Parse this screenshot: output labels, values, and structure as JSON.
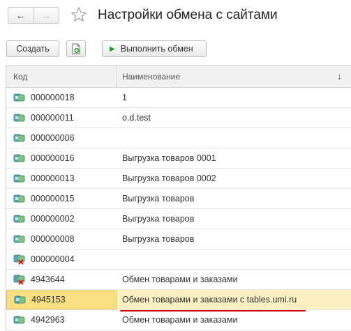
{
  "window": {
    "title": "Настройки обмена с сайтами",
    "nav": {
      "back_icon": "arrow-left-icon",
      "forward_icon": "arrow-right-icon"
    },
    "favorite_icon": "star-icon"
  },
  "toolbar": {
    "create_label": "Создать",
    "copy_icon": "copy-document-icon",
    "run_label": "Выполнить обмен",
    "run_icon": "play-icon"
  },
  "table": {
    "columns": {
      "code": "Код",
      "name": "Наименование",
      "sort_icon": "sort-arrow-down-icon"
    },
    "rows": [
      {
        "code": "000000018",
        "name": "1",
        "marked_for_deletion": false,
        "selected": false
      },
      {
        "code": "000000011",
        "name": "o.d.test",
        "marked_for_deletion": false,
        "selected": false
      },
      {
        "code": "000000006",
        "name": "",
        "marked_for_deletion": false,
        "selected": false
      },
      {
        "code": "000000016",
        "name": "Выгрузка товаров 0001",
        "marked_for_deletion": false,
        "selected": false
      },
      {
        "code": "000000013",
        "name": "Выгрузка товаров 0002",
        "marked_for_deletion": false,
        "selected": false
      },
      {
        "code": "000000015",
        "name": "Выгрузка товаров",
        "marked_for_deletion": false,
        "selected": false
      },
      {
        "code": "000000002",
        "name": "Выгрузка товаров",
        "marked_for_deletion": false,
        "selected": false
      },
      {
        "code": "000000008",
        "name": "Выгрузка товаров",
        "marked_for_deletion": false,
        "selected": false
      },
      {
        "code": "000000004",
        "name": "",
        "marked_for_deletion": true,
        "selected": false
      },
      {
        "code": "4943644",
        "name": "Обмен товарами и заказами",
        "marked_for_deletion": true,
        "selected": false
      },
      {
        "code": "4945153",
        "name": "Обмен товарами и заказами с tables.umi.ru",
        "marked_for_deletion": false,
        "selected": true
      },
      {
        "code": "4942963",
        "name": "Обмен товарами и заказами",
        "marked_for_deletion": false,
        "selected": false
      }
    ]
  },
  "colors": {
    "selected_row": "#fbf0c2",
    "selected_cell": "#f7df82",
    "annotation_underline": "#d40000",
    "run_icon": "#1f9b2a"
  }
}
